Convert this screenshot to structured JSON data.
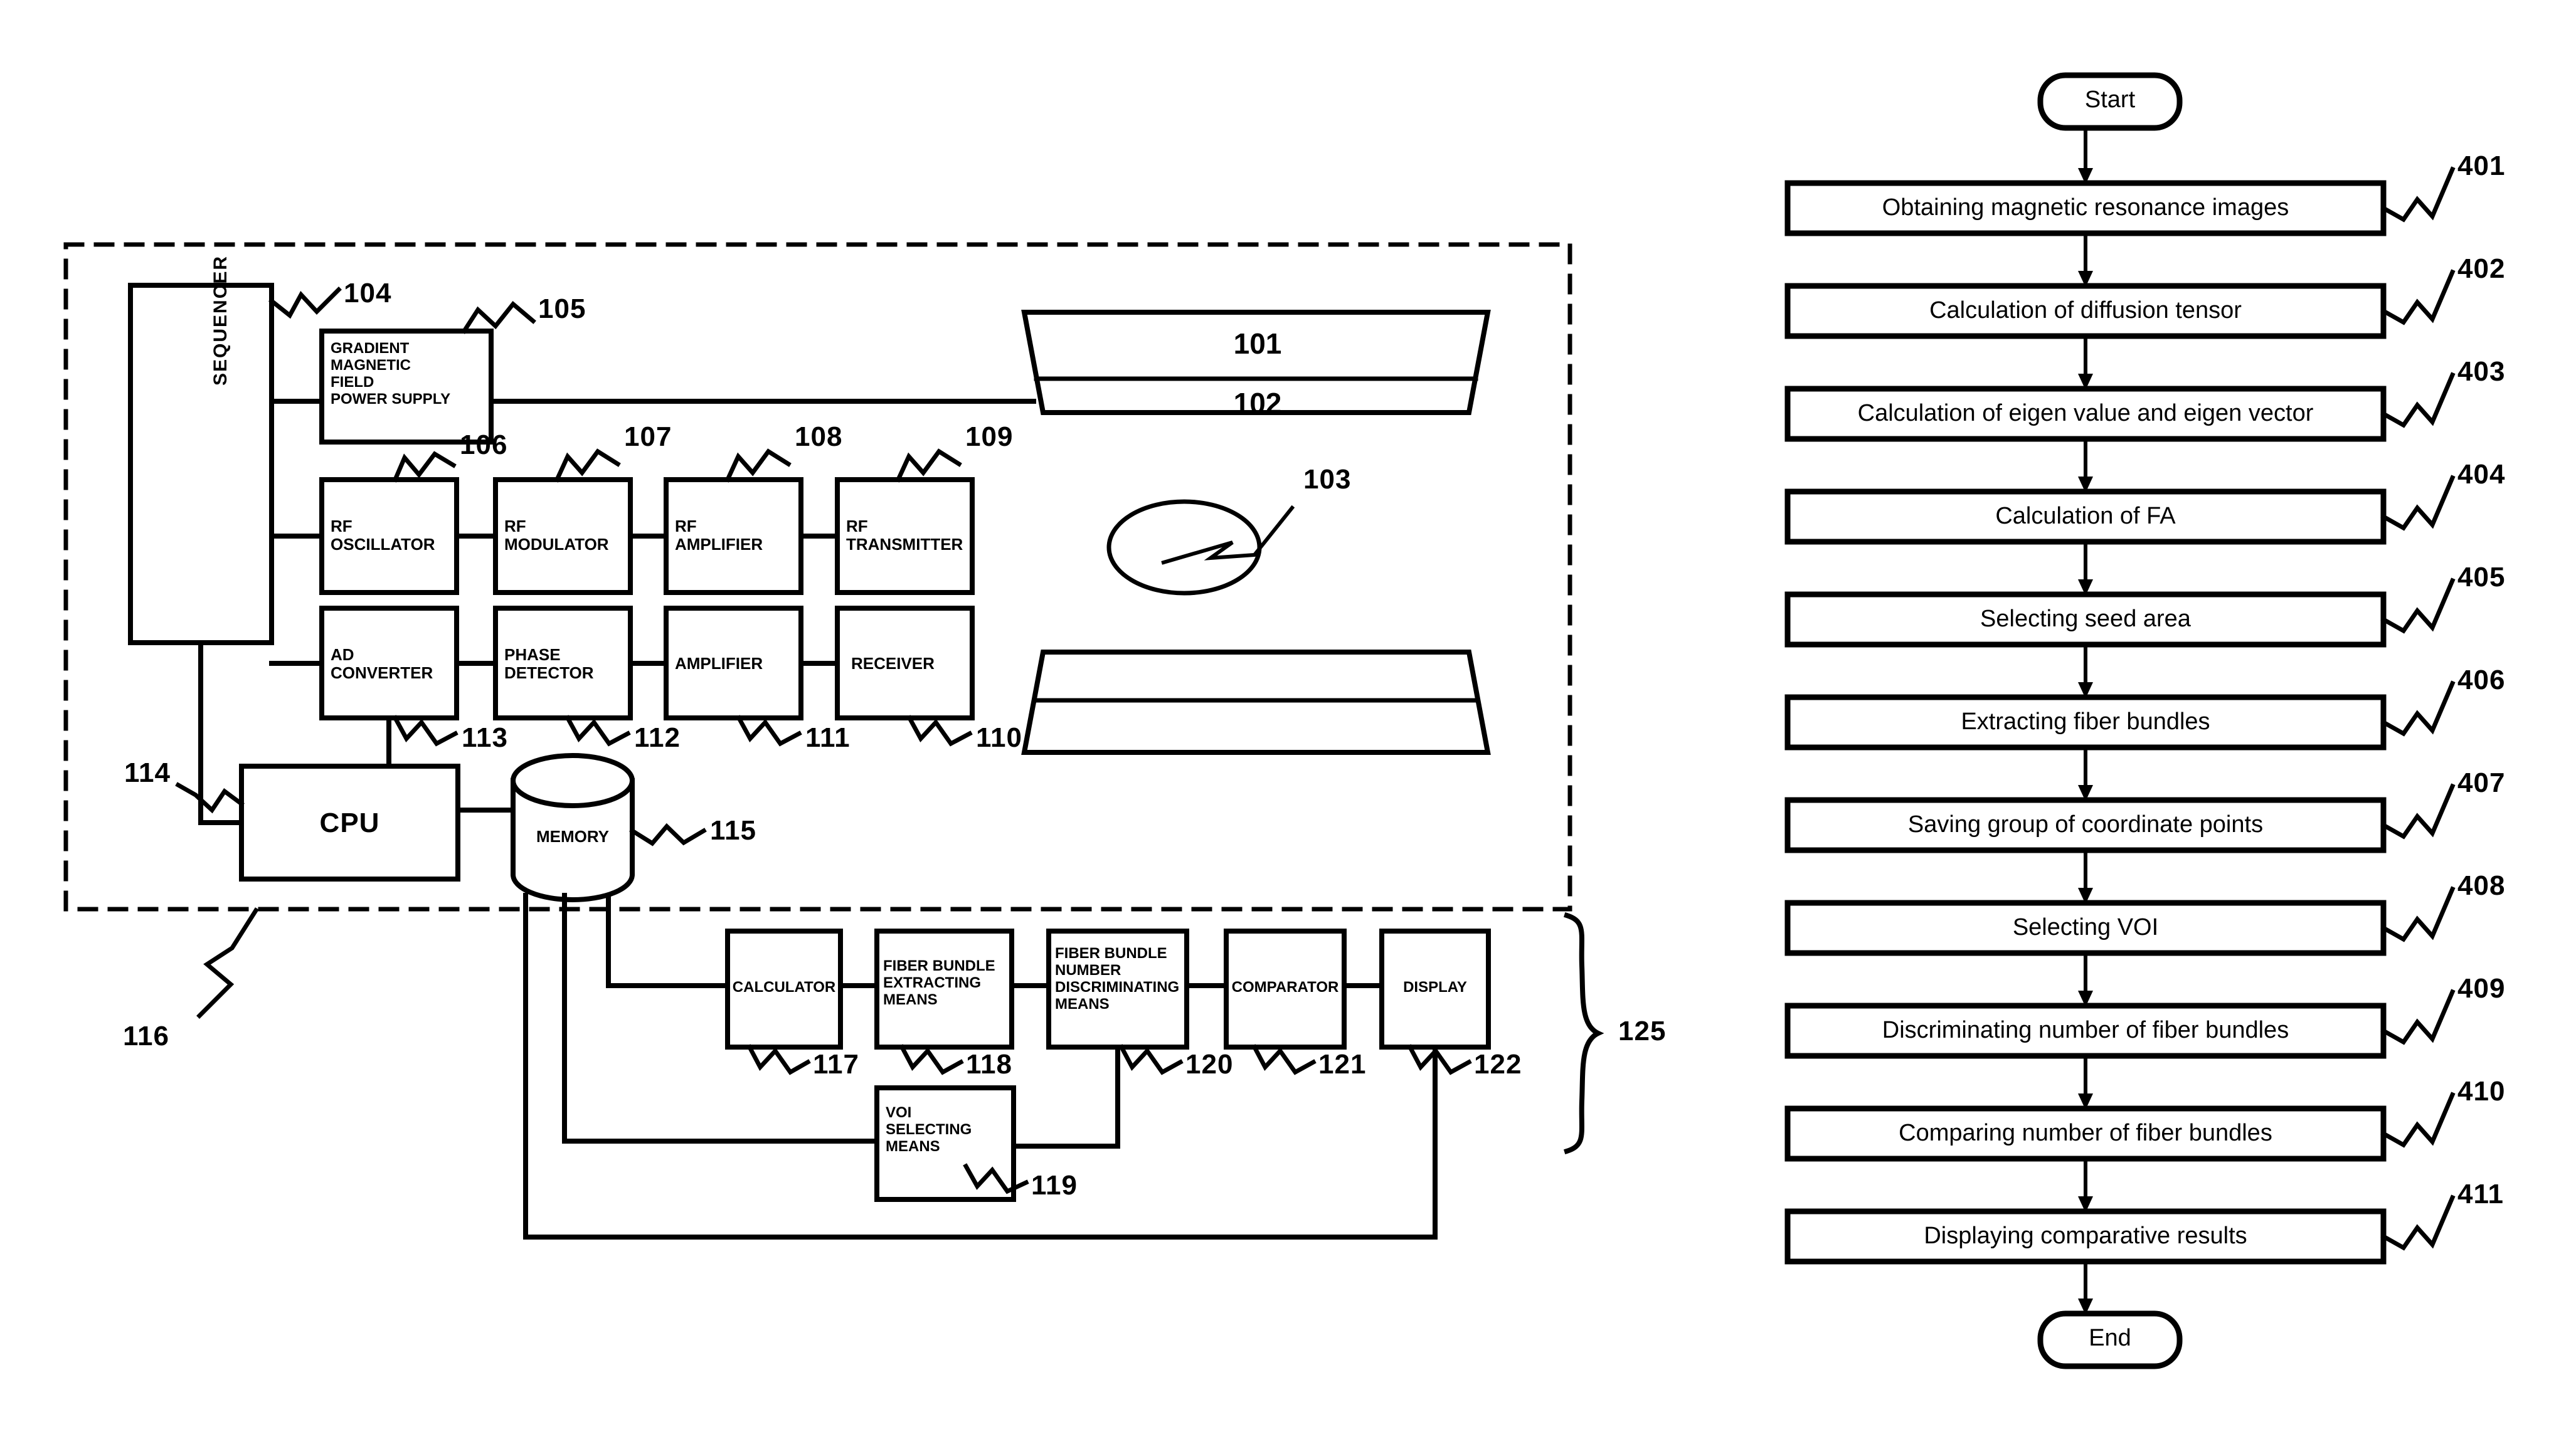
{
  "figure": {
    "type": "patent-figure",
    "description": "MRI apparatus block diagram with fiber-bundle analysis flowchart"
  },
  "block_diagram": {
    "blocks": [
      {
        "id": "sequencer",
        "label": "SEQUENCER",
        "ref": "104"
      },
      {
        "id": "gradient",
        "label": "GRADIENT\nMAGNETIC\nFIELD\nPOWER SUPPLY",
        "ref": "105"
      },
      {
        "id": "rf_osc",
        "label": "RF\nOSCILLATOR",
        "ref": "106"
      },
      {
        "id": "rf_mod",
        "label": "RF\nMODULATOR",
        "ref": "107"
      },
      {
        "id": "rf_amp",
        "label": "RF\nAMPLIFIER",
        "ref": "108"
      },
      {
        "id": "rf_tx",
        "label": "RF\nTRANSMITTER",
        "ref": "109"
      },
      {
        "id": "ad_conv",
        "label": "AD\nCONVERTER",
        "ref": "113"
      },
      {
        "id": "phase_det",
        "label": "PHASE\nDETECTOR",
        "ref": "112"
      },
      {
        "id": "amplifier",
        "label": "AMPLIFIER",
        "ref": "111"
      },
      {
        "id": "receiver",
        "label": "RECEIVER",
        "ref": "110"
      },
      {
        "id": "cpu",
        "label": "CPU",
        "ref": "114"
      },
      {
        "id": "memory",
        "label": "MEMORY",
        "ref": "115"
      },
      {
        "id": "calculator",
        "label": "CALCULATOR",
        "ref": "117"
      },
      {
        "id": "fb_extract",
        "label": "FIBER BUNDLE\nEXTRACTING\nMEANS",
        "ref": "118"
      },
      {
        "id": "voi_select",
        "label": "VOI\nSELECTING\nMEANS",
        "ref": "119"
      },
      {
        "id": "fb_number",
        "label": "FIBER BUNDLE\nNUMBER\nDISCRIMINATING\nMEANS",
        "ref": "120"
      },
      {
        "id": "comparator",
        "label": "COMPARATOR",
        "ref": "121"
      },
      {
        "id": "display",
        "label": "DISPLAY",
        "ref": "122"
      }
    ],
    "magnet": {
      "upper_ref": "101",
      "lower_ref": "102",
      "subject_ref": "103"
    },
    "group_refs": {
      "apparatus_ref": "116",
      "processing_unit_ref": "125"
    }
  },
  "flowchart": {
    "start_label": "Start",
    "end_label": "End",
    "steps": [
      {
        "ref": "401",
        "label": "Obtaining magnetic resonance images"
      },
      {
        "ref": "402",
        "label": "Calculation of diffusion tensor"
      },
      {
        "ref": "403",
        "label": "Calculation of eigen value and eigen vector"
      },
      {
        "ref": "404",
        "label": "Calculation of FA"
      },
      {
        "ref": "405",
        "label": "Selecting seed area"
      },
      {
        "ref": "406",
        "label": "Extracting fiber bundles"
      },
      {
        "ref": "407",
        "label": "Saving group of coordinate points"
      },
      {
        "ref": "408",
        "label": "Selecting VOI"
      },
      {
        "ref": "409",
        "label": "Discriminating number of fiber bundles"
      },
      {
        "ref": "410",
        "label": "Comparing number of fiber bundles"
      },
      {
        "ref": "411",
        "label": "Displaying comparative results"
      }
    ]
  },
  "colors": {
    "ink": "#000000",
    "paper": "#ffffff"
  }
}
